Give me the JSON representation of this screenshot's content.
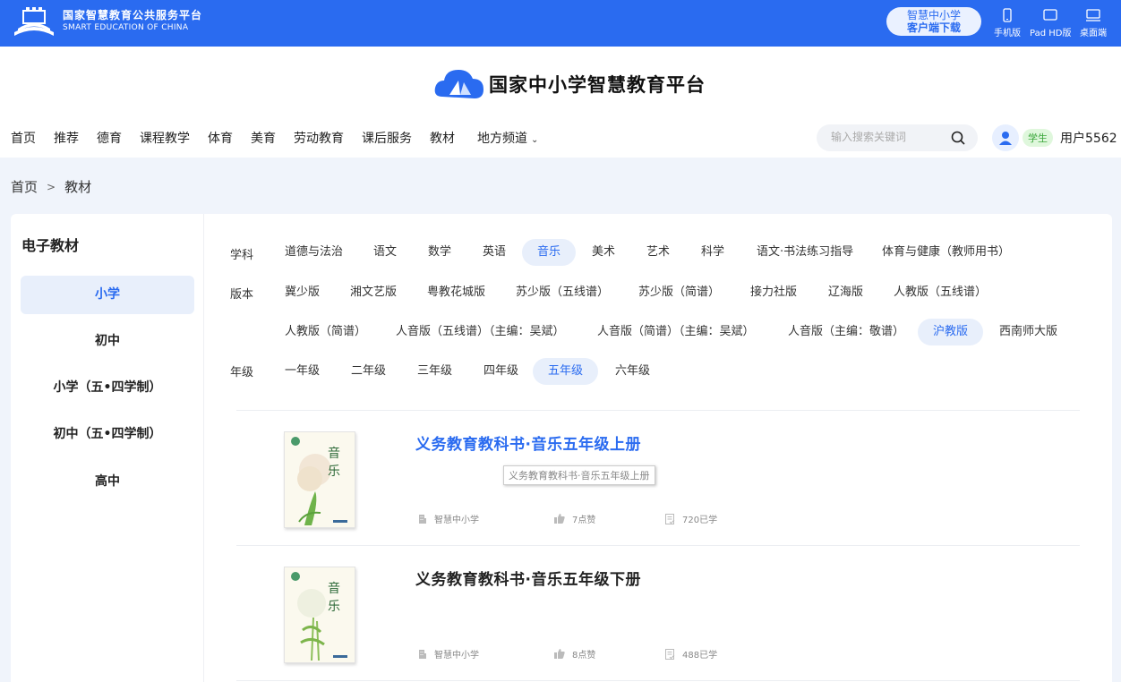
{
  "topbar": {
    "brand_cn": "国家智慧教育公共服务平台",
    "brand_en": "SMART EDUCATION OF CHINA",
    "download_line1": "智慧中小学",
    "download_line2": "客户端下载",
    "devices": [
      {
        "label": "手机版",
        "icon": "mobile-icon"
      },
      {
        "label": "Pad HD版",
        "icon": "tablet-icon"
      },
      {
        "label": "桌面端",
        "icon": "desktop-icon"
      }
    ]
  },
  "header": {
    "logo_text": "国家中小学智慧教育平台",
    "nav": [
      "首页",
      "推荐",
      "德育",
      "课程教学",
      "体育",
      "美育",
      "劳动教育",
      "课后服务",
      "教材",
      "地方频道"
    ],
    "search_placeholder": "输入搜索关键词",
    "role_badge": "学生",
    "username": "用户5562"
  },
  "breadcrumb": [
    "首页",
    "教材"
  ],
  "sidebar": {
    "title": "电子教材",
    "items": [
      "小学",
      "初中",
      "小学（五•四学制）",
      "初中（五•四学制）",
      "高中"
    ],
    "active_index": 0
  },
  "filters": {
    "subject_label": "学科",
    "subjects": [
      "道德与法治",
      "语文",
      "数学",
      "英语",
      "音乐",
      "美术",
      "艺术",
      "科学",
      "语文·书法练习指导",
      "体育与健康（教师用书）"
    ],
    "subject_active": "音乐",
    "edition_label": "版本",
    "editions_row1": [
      "冀少版",
      "湘文艺版",
      "粤教花城版",
      "苏少版（五线谱）",
      "苏少版（简谱）",
      "接力社版",
      "辽海版",
      "人教版（五线谱）"
    ],
    "editions_row2": [
      "人教版（简谱）",
      "人音版（五线谱）（主编：吴斌）",
      "人音版（简谱）（主编：吴斌）",
      "人音版（主编：敬谱）",
      "沪教版",
      "西南师大版"
    ],
    "edition_active": "沪教版",
    "grade_label": "年级",
    "grades": [
      "一年级",
      "二年级",
      "三年级",
      "四年级",
      "五年级",
      "六年级"
    ],
    "grade_active": "五年级"
  },
  "books": [
    {
      "title": "义务教育教科书·音乐五年级上册",
      "tooltip": "义务教育教科书·音乐五年级上册",
      "publisher": "智慧中小学",
      "likes": "7点赞",
      "learned": "720已学",
      "cover_text": "音乐"
    },
    {
      "title": "义务教育教科书·音乐五年级下册",
      "publisher": "智慧中小学",
      "likes": "8点赞",
      "learned": "488已学",
      "cover_text": "音乐"
    }
  ],
  "colors": {
    "brand_blue": "#2a6bf0",
    "active_bg": "#e8effb",
    "badge_green": "#3aa63a"
  }
}
